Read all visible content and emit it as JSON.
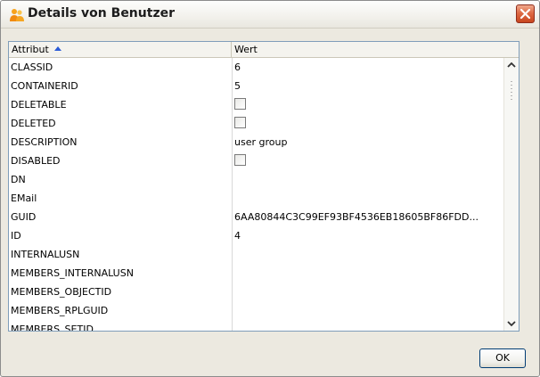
{
  "window": {
    "title": "Details von Benutzer",
    "icon": "user-group-icon",
    "close_icon": "close-icon"
  },
  "table": {
    "columns": [
      {
        "label": "Attribut",
        "sort": "ascending"
      },
      {
        "label": "Wert"
      }
    ],
    "rows": [
      {
        "attr": "CLASSID",
        "value": "6",
        "type": "text"
      },
      {
        "attr": "CONTAINERID",
        "value": "5",
        "type": "text"
      },
      {
        "attr": "DELETABLE",
        "value": "",
        "type": "checkbox",
        "checked": false
      },
      {
        "attr": "DELETED",
        "value": "",
        "type": "checkbox",
        "checked": false
      },
      {
        "attr": "DESCRIPTION",
        "value": "user group",
        "type": "text"
      },
      {
        "attr": "DISABLED",
        "value": "",
        "type": "checkbox",
        "checked": false
      },
      {
        "attr": "DN",
        "value": "",
        "type": "text"
      },
      {
        "attr": "EMail",
        "value": "",
        "type": "text"
      },
      {
        "attr": "GUID",
        "value": "6AA80844C3C99EF93BF4536EB18605BF86FDD...",
        "type": "text"
      },
      {
        "attr": "ID",
        "value": "4",
        "type": "text"
      },
      {
        "attr": "INTERNALUSN",
        "value": "",
        "type": "text"
      },
      {
        "attr": "MEMBERS_INTERNALUSN",
        "value": "",
        "type": "text"
      },
      {
        "attr": "MEMBERS_OBJECTID",
        "value": "",
        "type": "text"
      },
      {
        "attr": "MEMBERS_RPLGUID",
        "value": "",
        "type": "text"
      },
      {
        "attr": "MEMBERS_SETID",
        "value": "",
        "type": "text"
      }
    ]
  },
  "buttons": {
    "ok_label": "OK"
  },
  "colors": {
    "close_button": "#d9593a",
    "border": "#7f9db9",
    "sort_arrow": "#2a5bd7"
  }
}
